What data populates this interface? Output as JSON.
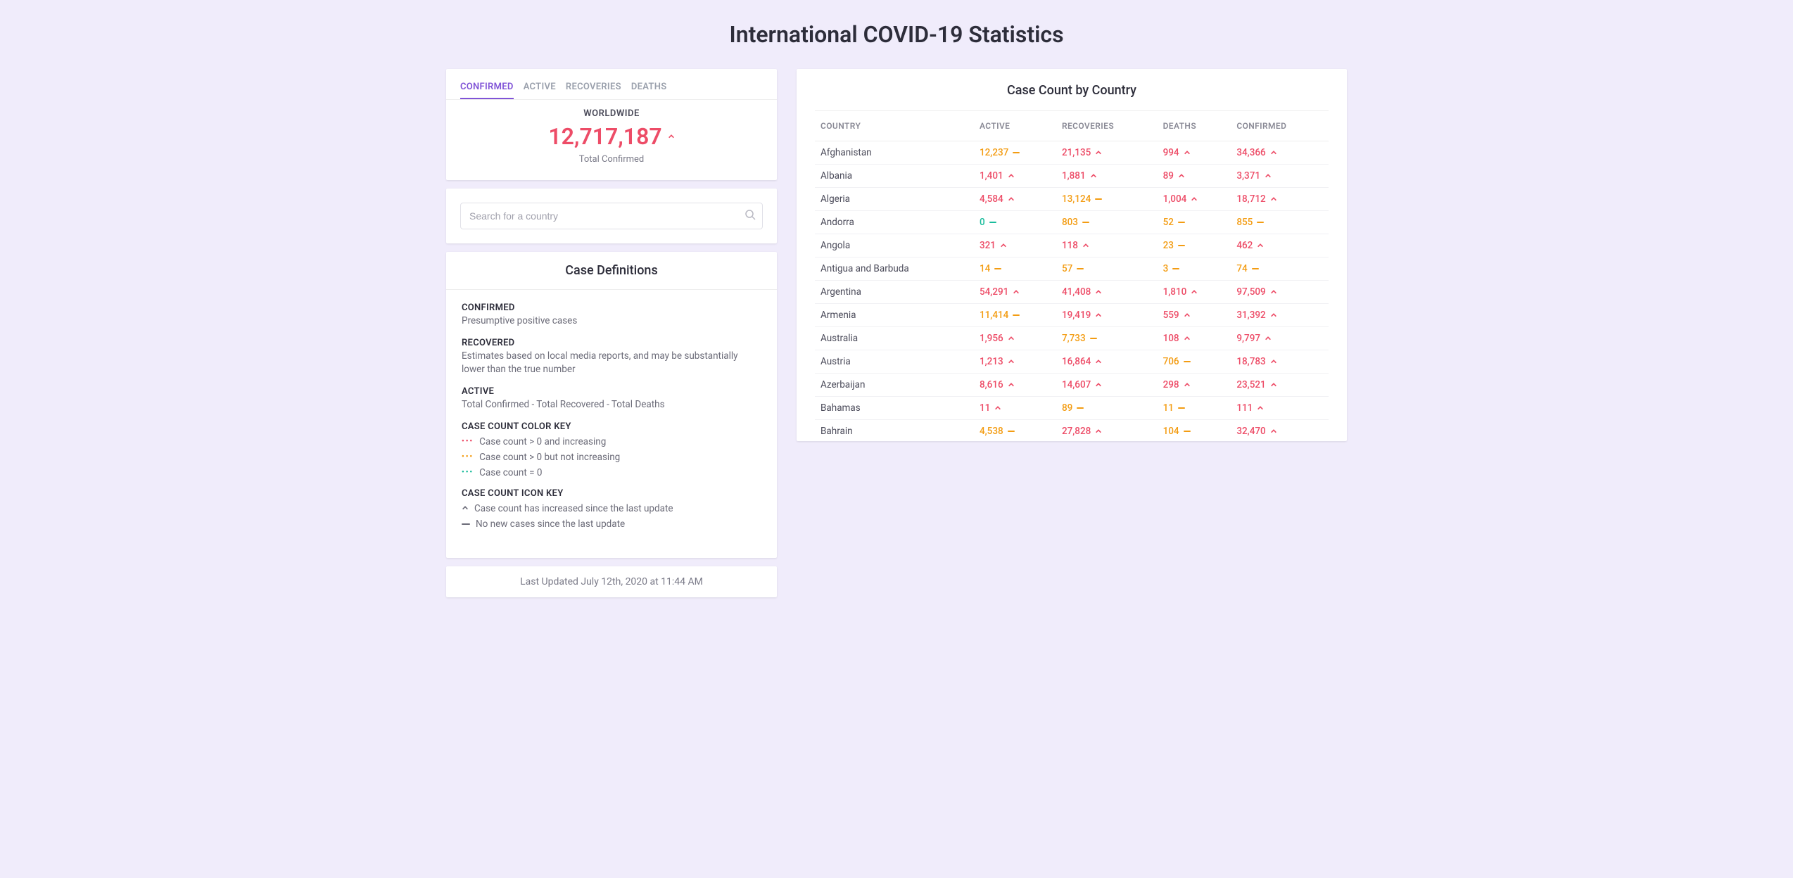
{
  "title": "International COVID-19 Statistics",
  "tabs": [
    "CONFIRMED",
    "ACTIVE",
    "RECOVERIES",
    "DEATHS"
  ],
  "active_tab": 0,
  "worldwide": {
    "label": "WORLDWIDE",
    "value": "12,717,187",
    "trend": "up",
    "sub": "Total Confirmed"
  },
  "search": {
    "placeholder": "Search for a country"
  },
  "definitions": {
    "title": "Case Definitions",
    "confirmed": {
      "head": "CONFIRMED",
      "desc": "Presumptive positive cases"
    },
    "recovered": {
      "head": "RECOVERED",
      "desc": "Estimates based on local media reports, and may be substantially lower than the true number"
    },
    "active": {
      "head": "ACTIVE",
      "desc": "Total Confirmed - Total Recovered - Total Deaths"
    },
    "color_key": {
      "head": "CASE COUNT COLOR KEY",
      "red": "Case count > 0 and increasing",
      "orange": "Case count > 0 but not increasing",
      "green": "Case count = 0"
    },
    "icon_key": {
      "head": "CASE COUNT ICON KEY",
      "up": "Case count has increased since the last update",
      "flat": "No new cases since the last update"
    }
  },
  "last_updated": "Last Updated July 12th, 2020 at 11:44 AM",
  "table": {
    "title": "Case Count by Country",
    "columns": [
      "COUNTRY",
      "ACTIVE",
      "RECOVERIES",
      "DEATHS",
      "CONFIRMED"
    ]
  },
  "chart_data": {
    "type": "table",
    "title": "Case Count by Country",
    "columns": [
      "country",
      "active",
      "recoveries",
      "deaths",
      "confirmed"
    ],
    "rows": [
      {
        "country": "Afghanistan",
        "active": {
          "v": "12,237",
          "c": "orange",
          "t": "flat"
        },
        "recoveries": {
          "v": "21,135",
          "c": "red",
          "t": "up"
        },
        "deaths": {
          "v": "994",
          "c": "red",
          "t": "up"
        },
        "confirmed": {
          "v": "34,366",
          "c": "red",
          "t": "up"
        }
      },
      {
        "country": "Albania",
        "active": {
          "v": "1,401",
          "c": "red",
          "t": "up"
        },
        "recoveries": {
          "v": "1,881",
          "c": "red",
          "t": "up"
        },
        "deaths": {
          "v": "89",
          "c": "red",
          "t": "up"
        },
        "confirmed": {
          "v": "3,371",
          "c": "red",
          "t": "up"
        }
      },
      {
        "country": "Algeria",
        "active": {
          "v": "4,584",
          "c": "red",
          "t": "up"
        },
        "recoveries": {
          "v": "13,124",
          "c": "orange",
          "t": "flat"
        },
        "deaths": {
          "v": "1,004",
          "c": "red",
          "t": "up"
        },
        "confirmed": {
          "v": "18,712",
          "c": "red",
          "t": "up"
        }
      },
      {
        "country": "Andorra",
        "active": {
          "v": "0",
          "c": "green",
          "t": "flat"
        },
        "recoveries": {
          "v": "803",
          "c": "orange",
          "t": "flat"
        },
        "deaths": {
          "v": "52",
          "c": "orange",
          "t": "flat"
        },
        "confirmed": {
          "v": "855",
          "c": "orange",
          "t": "flat"
        }
      },
      {
        "country": "Angola",
        "active": {
          "v": "321",
          "c": "red",
          "t": "up"
        },
        "recoveries": {
          "v": "118",
          "c": "red",
          "t": "up"
        },
        "deaths": {
          "v": "23",
          "c": "orange",
          "t": "flat"
        },
        "confirmed": {
          "v": "462",
          "c": "red",
          "t": "up"
        }
      },
      {
        "country": "Antigua and Barbuda",
        "active": {
          "v": "14",
          "c": "orange",
          "t": "flat"
        },
        "recoveries": {
          "v": "57",
          "c": "orange",
          "t": "flat"
        },
        "deaths": {
          "v": "3",
          "c": "orange",
          "t": "flat"
        },
        "confirmed": {
          "v": "74",
          "c": "orange",
          "t": "flat"
        }
      },
      {
        "country": "Argentina",
        "active": {
          "v": "54,291",
          "c": "red",
          "t": "up"
        },
        "recoveries": {
          "v": "41,408",
          "c": "red",
          "t": "up"
        },
        "deaths": {
          "v": "1,810",
          "c": "red",
          "t": "up"
        },
        "confirmed": {
          "v": "97,509",
          "c": "red",
          "t": "up"
        }
      },
      {
        "country": "Armenia",
        "active": {
          "v": "11,414",
          "c": "orange",
          "t": "flat"
        },
        "recoveries": {
          "v": "19,419",
          "c": "red",
          "t": "up"
        },
        "deaths": {
          "v": "559",
          "c": "red",
          "t": "up"
        },
        "confirmed": {
          "v": "31,392",
          "c": "red",
          "t": "up"
        }
      },
      {
        "country": "Australia",
        "active": {
          "v": "1,956",
          "c": "red",
          "t": "up"
        },
        "recoveries": {
          "v": "7,733",
          "c": "orange",
          "t": "flat"
        },
        "deaths": {
          "v": "108",
          "c": "red",
          "t": "up"
        },
        "confirmed": {
          "v": "9,797",
          "c": "red",
          "t": "up"
        }
      },
      {
        "country": "Austria",
        "active": {
          "v": "1,213",
          "c": "red",
          "t": "up"
        },
        "recoveries": {
          "v": "16,864",
          "c": "red",
          "t": "up"
        },
        "deaths": {
          "v": "706",
          "c": "orange",
          "t": "flat"
        },
        "confirmed": {
          "v": "18,783",
          "c": "red",
          "t": "up"
        }
      },
      {
        "country": "Azerbaijan",
        "active": {
          "v": "8,616",
          "c": "red",
          "t": "up"
        },
        "recoveries": {
          "v": "14,607",
          "c": "red",
          "t": "up"
        },
        "deaths": {
          "v": "298",
          "c": "red",
          "t": "up"
        },
        "confirmed": {
          "v": "23,521",
          "c": "red",
          "t": "up"
        }
      },
      {
        "country": "Bahamas",
        "active": {
          "v": "11",
          "c": "red",
          "t": "up"
        },
        "recoveries": {
          "v": "89",
          "c": "orange",
          "t": "flat"
        },
        "deaths": {
          "v": "11",
          "c": "orange",
          "t": "flat"
        },
        "confirmed": {
          "v": "111",
          "c": "red",
          "t": "up"
        }
      },
      {
        "country": "Bahrain",
        "active": {
          "v": "4,538",
          "c": "orange",
          "t": "flat"
        },
        "recoveries": {
          "v": "27,828",
          "c": "red",
          "t": "up"
        },
        "deaths": {
          "v": "104",
          "c": "orange",
          "t": "flat"
        },
        "confirmed": {
          "v": "32,470",
          "c": "red",
          "t": "up"
        }
      }
    ]
  }
}
